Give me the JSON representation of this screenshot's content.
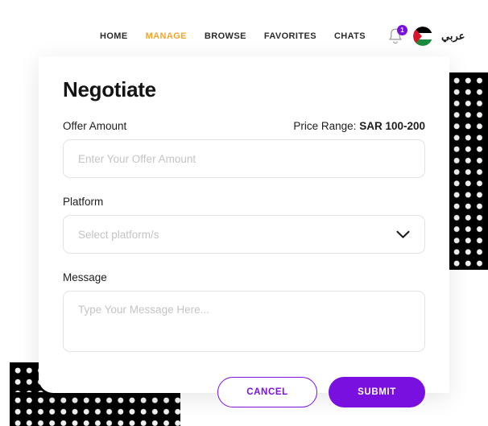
{
  "header": {
    "logo_icon": "brand-loop-logo",
    "nav": [
      {
        "label": "HOME",
        "active": false
      },
      {
        "label": "MANAGE",
        "active": true
      },
      {
        "label": "BROWSE",
        "active": false
      },
      {
        "label": "FAVORITES",
        "active": false
      },
      {
        "label": "CHATS",
        "active": false
      }
    ],
    "bell_icon": "notification-bell-icon",
    "bell_badge": "1",
    "flag_icon": "palestine-flag-icon",
    "language_label": "عربي"
  },
  "modal": {
    "title": "Negotiate",
    "offer": {
      "label": "Offer Amount",
      "placeholder": "Enter Your Offer Amount",
      "value": ""
    },
    "price_range": {
      "prefix": "Price Range: ",
      "value": "SAR 100-200"
    },
    "platform": {
      "label": "Platform",
      "placeholder": "Select platform/s",
      "value": "",
      "chevron_icon": "chevron-down-icon"
    },
    "message": {
      "label": "Message",
      "placeholder": "Type Your Message Here...",
      "value": ""
    },
    "actions": {
      "cancel_label": "CANCEL",
      "submit_label": "SUBMIT"
    }
  },
  "theme": {
    "accent_purple": "#7a10e0",
    "accent_orange": "#f4a62a",
    "text_dark": "#1d1d1d",
    "placeholder_gray": "#c4c4c4",
    "border_gray": "#e3e3e3"
  }
}
